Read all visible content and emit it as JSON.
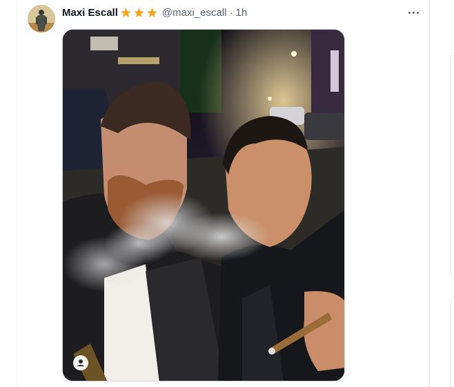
{
  "tweet": {
    "author": {
      "display_name": "Maxi Escall",
      "badges": [
        "star-icon",
        "star-icon",
        "star-icon"
      ],
      "handle": "@maxi_escall",
      "separator": "·",
      "time": "1h"
    },
    "menu_icon": "more-horizontal-icon",
    "media": {
      "kind": "photo",
      "watermark_icon": "user-icon"
    }
  },
  "colors": {
    "name": "#0f1419",
    "secondary": "#536471",
    "star": "#f4a623",
    "border": "#cfd9de"
  }
}
